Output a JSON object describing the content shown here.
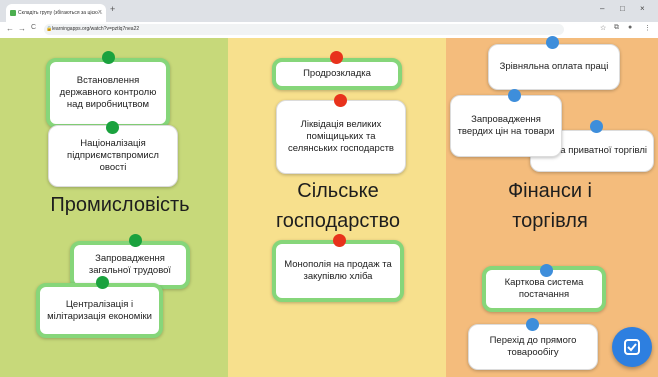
{
  "browser": {
    "tab_title": "Складіть групу (збігаються за цією…",
    "tab_close": "×",
    "new_tab": "+",
    "url": "learningapps.org/watch?v=pztlq7nea22",
    "nav_back": "←",
    "nav_forward": "→",
    "nav_reload": "C",
    "window_minimize": "–",
    "window_maximize": "□",
    "window_close": "×"
  },
  "columns": [
    {
      "heading": "Промисловість",
      "color": "#c7d97a"
    },
    {
      "heading_line1": "Сільське",
      "heading_line2": "господарство",
      "color": "#f7e08d"
    },
    {
      "heading_line1": "Фінанси і",
      "heading_line2": "торгівля",
      "color": "#f4bc7c"
    }
  ],
  "cards": {
    "c1": "Встановлення державного контролю над виробництвом",
    "c2": "Націоналізація підприємствпромисл овості",
    "c3": "Запровадження загальної трудової",
    "c4": "Централізація і мілітаризація економіки",
    "c5": "Продрозкладка",
    "c6": "Ліквідація великих поміщицьких та селянських господарств",
    "c7": "Монополія на продаж та закупівлю хліба",
    "c8": "Зрівняльна оплата праці",
    "c9": "Запровадження твердих цін на товари",
    "c10": "на приватної торгівлі",
    "c11": "Карткова система постачання",
    "c12": "Перехід до прямого товарообігу"
  },
  "pin_colors": {
    "correct": "#1aa23e",
    "wrong": "#e8321c",
    "neutral": "#3e8edb"
  },
  "check_button_icon": "check-icon"
}
